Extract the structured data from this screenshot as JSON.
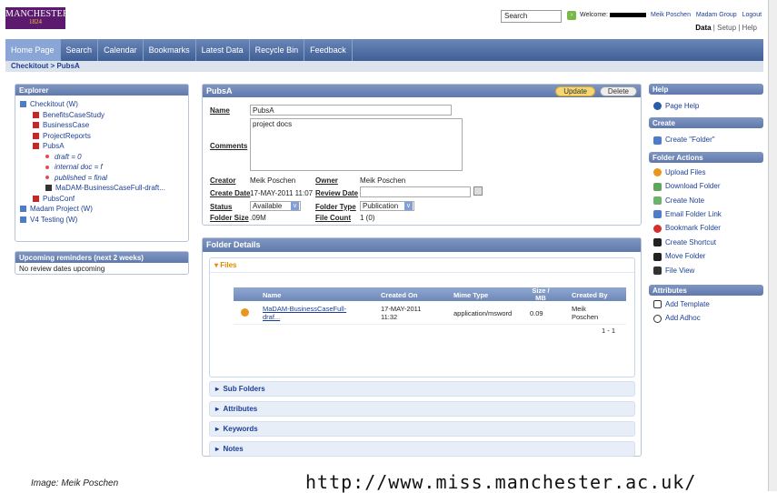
{
  "header": {
    "logo_top": "MANCHESTER",
    "logo_year": "1824",
    "search_label": "Search",
    "welcome": "Welcome:",
    "user": "Meik Poschen",
    "group": "Madam Group",
    "logout": "Logout",
    "data": "Data",
    "setup": "Setup",
    "help": "Help"
  },
  "nav": {
    "items": [
      "Home Page",
      "Search",
      "Calendar",
      "Bookmarks",
      "Latest Data",
      "Recycle Bin",
      "Feedback"
    ]
  },
  "breadcrumb": "Checkitout > PubsA",
  "explorer": {
    "title": "Explorer",
    "items": [
      "Checkitout (W)",
      "BenefitsCaseStudy",
      "BusinessCase",
      "ProjectReports",
      "PubsA",
      "draft = 0",
      "internal doc = f",
      "published = final",
      "MaDAM-BusinessCaseFull-draft...",
      "PubsConf",
      "Madam Project (W)",
      "V4 Testing (W)"
    ]
  },
  "reminders": {
    "title": "Upcoming reminders (next 2 weeks)",
    "body": "No review dates upcoming"
  },
  "folder": {
    "title": "PubsA",
    "update": "Update",
    "delete": "Delete",
    "name_label": "Name",
    "name_value": "PubsA",
    "comments_label": "Comments",
    "comments_value": "project docs",
    "creator_label": "Creator",
    "creator_value": "Meik Poschen",
    "owner_label": "Owner",
    "owner_value": "Meik Poschen",
    "create_date_label": "Create Date",
    "create_date_value": "17-MAY-2011 11:07",
    "review_date_label": "Review Date",
    "status_label": "Status",
    "status_value": "Available",
    "folder_type_label": "Folder Type",
    "folder_type_value": "Publication",
    "folder_size_label": "Folder Size",
    "folder_size_value": ".09M",
    "file_count_label": "File Count",
    "file_count_value": "1 (0)"
  },
  "details": {
    "title": "Folder Details",
    "files_label": "Files",
    "columns": [
      "Name",
      "Created On",
      "Mime Type",
      "Size / MB",
      "Created By"
    ],
    "row": {
      "name": "MaDAM-BusinessCaseFull-draf...",
      "created_on": "17-MAY-2011 11:32",
      "mime": "application/msword",
      "size": "0.09",
      "created_by": "Meik Poschen"
    },
    "pager": "1 - 1",
    "sections": [
      "Sub Folders",
      "Attributes",
      "Keywords",
      "Notes"
    ]
  },
  "right": {
    "help_title": "Help",
    "page_help": "Page Help",
    "create_title": "Create",
    "create_folder": "Create \"Folder\"",
    "actions_title": "Folder Actions",
    "actions": [
      "Upload Files",
      "Download Folder",
      "Create Note",
      "Email Folder Link",
      "Bookmark Folder",
      "Create Shortcut",
      "Move Folder",
      "File View"
    ],
    "attributes_title": "Attributes",
    "add_template": "Add Template",
    "add_adhoc": "Add Adhoc"
  },
  "footer": {
    "credit": "Image: Meik Poschen",
    "url": "http://www.miss.manchester.ac.uk/"
  }
}
